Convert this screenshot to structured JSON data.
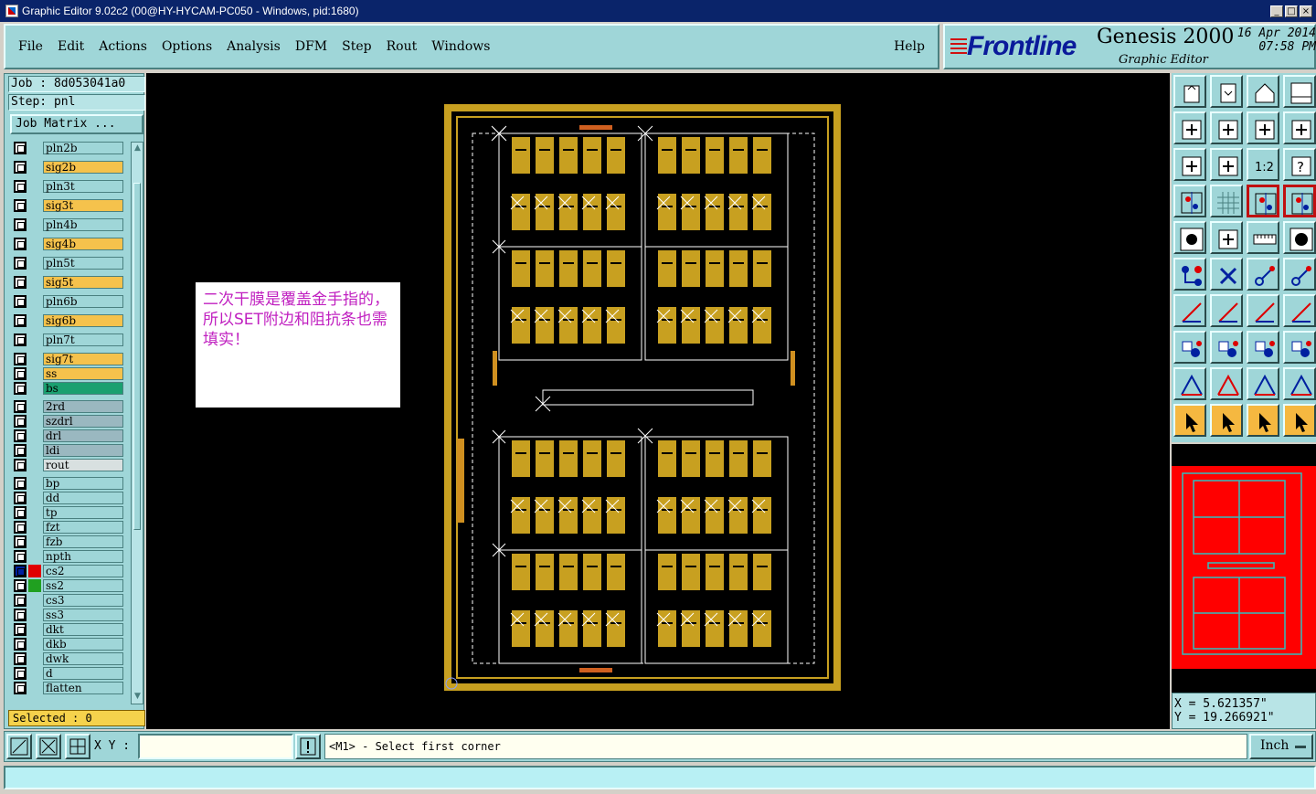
{
  "window": {
    "title": "Graphic Editor 9.02c2 (00@HY-HYCAM-PC050 - Windows, pid:1680)",
    "controls": [
      "_",
      "□",
      "×"
    ]
  },
  "menu": {
    "items": [
      {
        "label": "File"
      },
      {
        "label": "Edit"
      },
      {
        "label": "Actions"
      },
      {
        "label": "Options"
      },
      {
        "label": "Analysis"
      },
      {
        "label": "DFM"
      },
      {
        "label": "Step"
      },
      {
        "label": "Rout"
      },
      {
        "label": "Windows"
      }
    ],
    "help": "Help"
  },
  "brand": {
    "logo": "Frontline",
    "product": "Genesis 2000",
    "subtitle": "Graphic Editor",
    "date": "16 Apr 2014",
    "time": "07:58 PM"
  },
  "job": {
    "job_line": "Job : 8d053041a0",
    "step_line": "Step: pnl",
    "matrix_button": "Job Matrix ..."
  },
  "layers": [
    {
      "name": "pln2b",
      "color": "#9fd6d8"
    },
    {
      "name": "sig2b",
      "color": "#f5c24c"
    },
    {
      "name": "pln3t",
      "color": "#9fd6d8"
    },
    {
      "name": "sig3t",
      "color": "#f5c24c"
    },
    {
      "name": "pln4b",
      "color": "#9fd6d8"
    },
    {
      "name": "sig4b",
      "color": "#f5c24c"
    },
    {
      "name": "pln5t",
      "color": "#9fd6d8"
    },
    {
      "name": "sig5t",
      "color": "#f5c24c"
    },
    {
      "name": "pln6b",
      "color": "#9fd6d8"
    },
    {
      "name": "sig6b",
      "color": "#f5c24c"
    },
    {
      "name": "pln7t",
      "color": "#9fd6d8"
    },
    {
      "name": "sig7t",
      "color": "#f5c24c"
    },
    {
      "name": "ss",
      "color": "#f5c24c"
    },
    {
      "name": "bs",
      "color": "#1aa070"
    },
    {
      "name": "2rd",
      "color": "#9ab8c0"
    },
    {
      "name": "szdrl",
      "color": "#9ab8c0"
    },
    {
      "name": "drl",
      "color": "#9ab8c0"
    },
    {
      "name": "ldi",
      "color": "#9ab8c0"
    },
    {
      "name": "rout",
      "color": "#d8e0e0"
    },
    {
      "name": "bp",
      "color": "#9fd6d8"
    },
    {
      "name": "dd",
      "color": "#9fd6d8"
    },
    {
      "name": "tp",
      "color": "#9fd6d8"
    },
    {
      "name": "fzt",
      "color": "#9fd6d8"
    },
    {
      "name": "fzb",
      "color": "#9fd6d8"
    },
    {
      "name": "npth",
      "color": "#9fd6d8"
    },
    {
      "name": "cs2",
      "color": "#9fd6d8",
      "swatch": "#e00000",
      "active": true
    },
    {
      "name": "ss2",
      "color": "#9fd6d8",
      "swatch": "#20a020"
    },
    {
      "name": "cs3",
      "color": "#9fd6d8"
    },
    {
      "name": "ss3",
      "color": "#9fd6d8"
    },
    {
      "name": "dkt",
      "color": "#9fd6d8"
    },
    {
      "name": "dkb",
      "color": "#9fd6d8"
    },
    {
      "name": "dwk",
      "color": "#9fd6d8"
    },
    {
      "name": "d",
      "color": "#9fd6d8"
    },
    {
      "name": "flatten",
      "color": "#9fd6d8"
    }
  ],
  "selection": {
    "label": "Selected : 0"
  },
  "note": {
    "text": "二次干膜是覆盖金手指的，所以SET附边和阻抗条也需填实！"
  },
  "colors": {
    "pad_gold": "#c8a020",
    "canvas": "#000000",
    "outline": "#ffffff",
    "minimap_fill": "#ff0000",
    "minimap_line": "#30c0c0"
  },
  "coords": {
    "x": "X = 5.621357\"",
    "y": "Y = 19.266921\""
  },
  "bottom": {
    "xy_label": "X Y :",
    "xy_value": "",
    "prompt": "<M1> - Select first corner",
    "units": "Inch"
  },
  "toolbar_icons": [
    "zoom-home-icon",
    "zoom-page-icon",
    "zoom-step-icon",
    "zoom-window-icon",
    "pan-left-icon",
    "pan-right-icon",
    "zoom-fit-icon",
    "repeat-icon",
    "zoom-in-icon",
    "zoom-out-icon",
    "one-to-one-icon",
    "help-icon",
    "measure-tools-icon",
    "grid-icon",
    "snap-icon",
    "snap-center-icon",
    "pad-icon",
    "line-icon",
    "ruler-icon",
    "circle-icon",
    "connect-icon",
    "cross-icon",
    "move-icon",
    "copy-icon",
    "angle-icon",
    "slope-icon",
    "rotate-icon",
    "mirror-icon",
    "surface-icon",
    "draw-icon",
    "dimension-icon",
    "polygon-icon",
    "arc-red-icon",
    "arc-blue-icon",
    "arc-both-icon",
    "arc-triangle-icon",
    "select-icon",
    "select-box-icon",
    "select-poly-icon",
    "select-net-icon"
  ]
}
